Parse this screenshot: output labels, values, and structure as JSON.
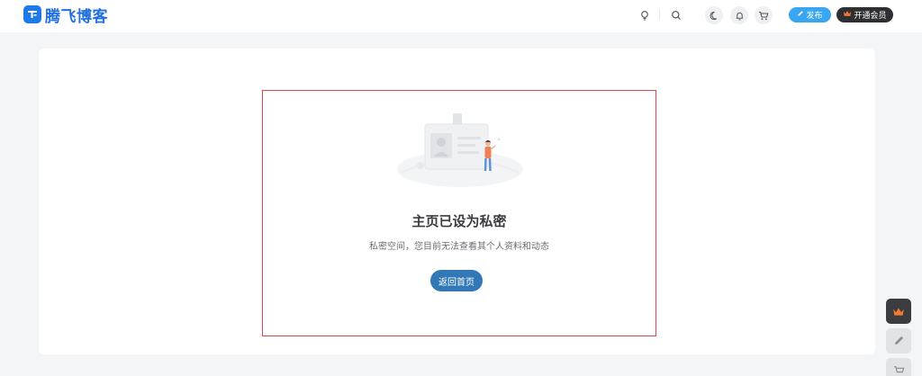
{
  "header": {
    "logo_text": "腾飞博客",
    "publish_label": "发布",
    "vip_label": "开通会员",
    "icons": [
      "lightbulb-icon",
      "search-icon",
      "moon-icon",
      "bell-icon",
      "cart-icon"
    ]
  },
  "main": {
    "title": "主页已设为私密",
    "subtitle": "私密空间，您目前无法查看其个人资料和动态",
    "home_button_label": "返回首页",
    "illustration": "private-profile-illustration"
  },
  "float_bar": {
    "icons": [
      "crown-icon",
      "pencil-icon",
      "cart-icon"
    ]
  },
  "colors": {
    "brand_blue": "#1e7ae6",
    "publish_blue": "#3aa6f2",
    "vip_dark": "#2e2f33",
    "crown_orange": "#f07a32",
    "home_button": "#3278b6",
    "highlight_red": "#e0474c"
  }
}
